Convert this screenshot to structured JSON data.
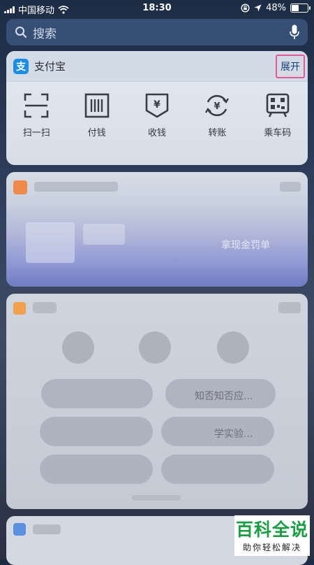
{
  "status": {
    "carrier": "中国移动",
    "time": "18:30",
    "battery": "48%",
    "battery_level": 0.48
  },
  "search": {
    "placeholder": "搜索"
  },
  "alipay": {
    "title": "支付宝",
    "logo_char": "支",
    "expand_label": "展开",
    "actions": [
      {
        "label": "扫一扫",
        "icon": "scan-icon"
      },
      {
        "label": "付钱",
        "icon": "barcode-pay-icon"
      },
      {
        "label": "收钱",
        "icon": "receive-money-icon"
      },
      {
        "label": "转账",
        "icon": "transfer-icon"
      },
      {
        "label": "乘车码",
        "icon": "transit-code-icon"
      }
    ]
  },
  "blurred": {
    "card2_text": "拿现金罚单",
    "card3_q1": "知否知否应...",
    "card3_q2": "学实验..."
  },
  "watermark": {
    "title": "百科全说",
    "subtitle": "助你轻松解决"
  },
  "colors": {
    "highlight": "#e8559b",
    "alipay_blue": "#1a8ee6",
    "watermark_green": "#1a9e44"
  }
}
